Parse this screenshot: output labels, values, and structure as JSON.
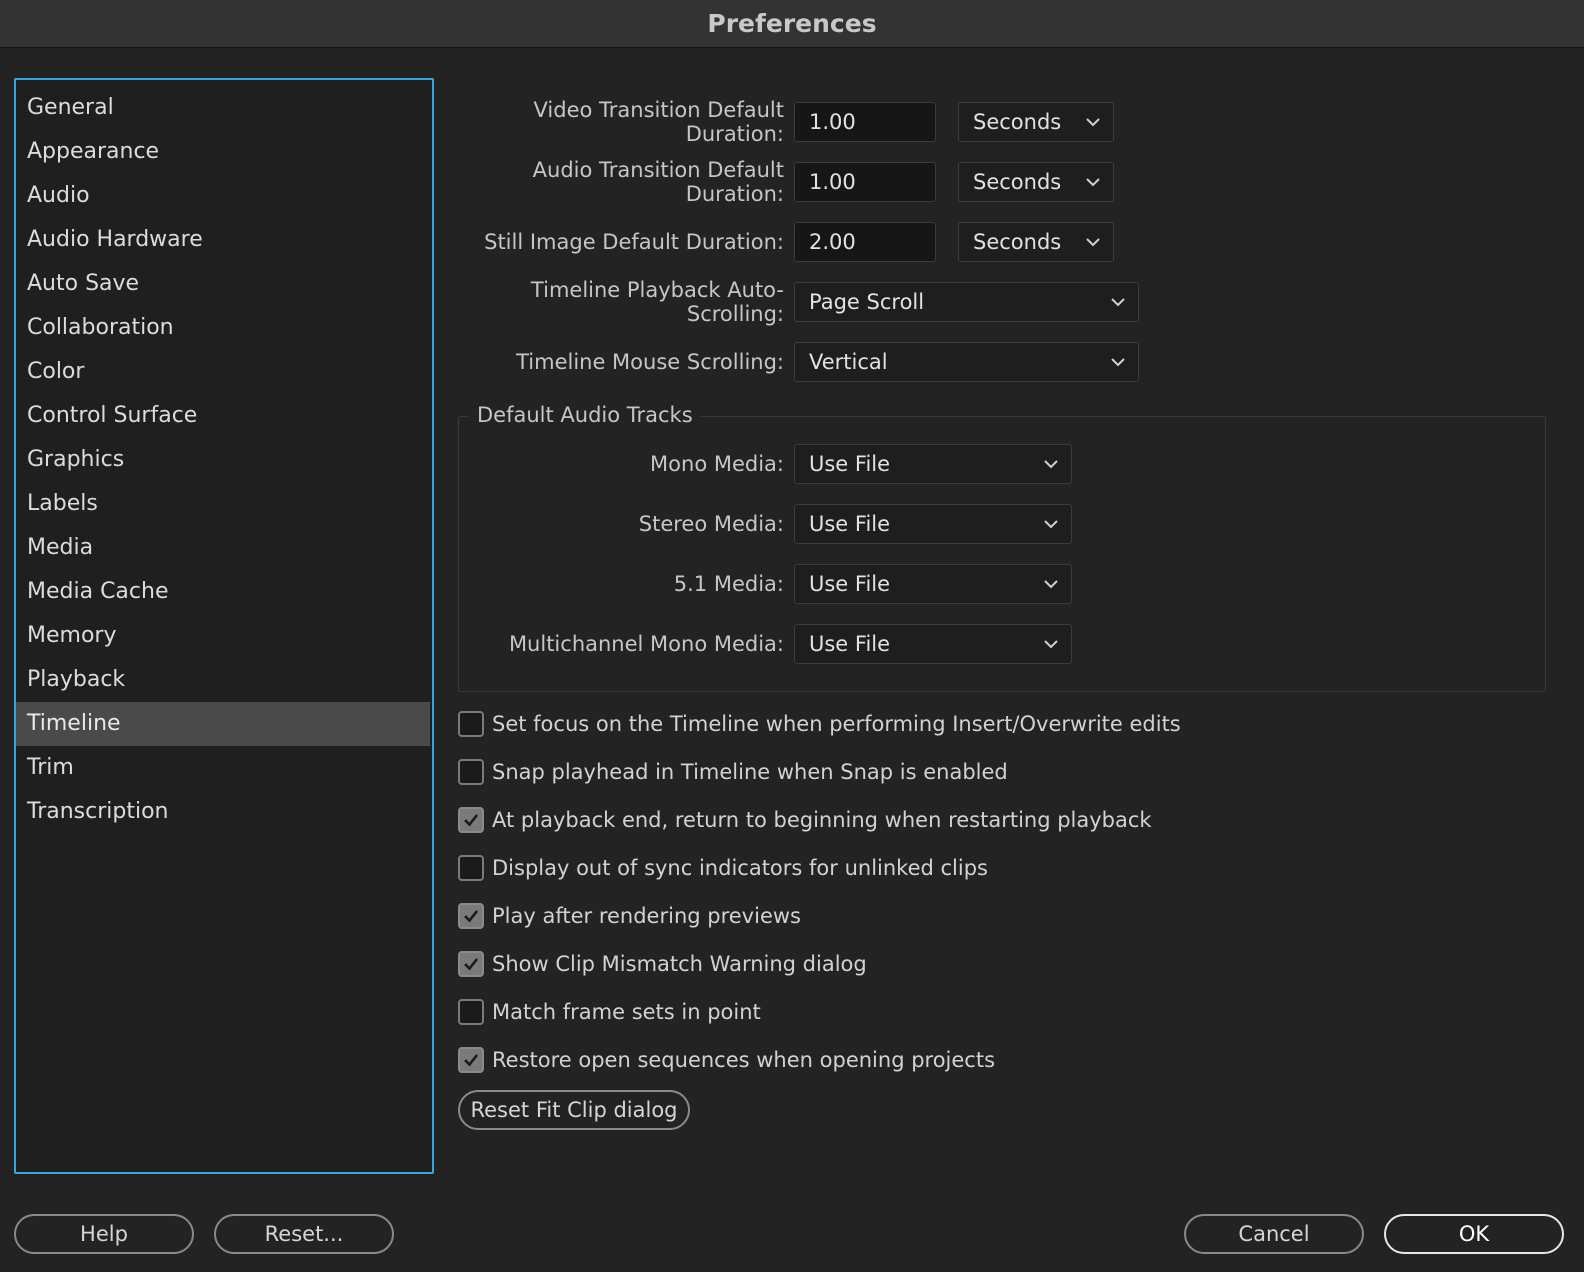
{
  "window": {
    "title": "Preferences"
  },
  "sidebar": {
    "items": [
      {
        "label": "General"
      },
      {
        "label": "Appearance"
      },
      {
        "label": "Audio"
      },
      {
        "label": "Audio Hardware"
      },
      {
        "label": "Auto Save"
      },
      {
        "label": "Collaboration"
      },
      {
        "label": "Color"
      },
      {
        "label": "Control Surface"
      },
      {
        "label": "Graphics"
      },
      {
        "label": "Labels"
      },
      {
        "label": "Media"
      },
      {
        "label": "Media Cache"
      },
      {
        "label": "Memory"
      },
      {
        "label": "Playback"
      },
      {
        "label": "Timeline"
      },
      {
        "label": "Trim"
      },
      {
        "label": "Transcription"
      }
    ],
    "selected": "Timeline"
  },
  "durations": {
    "video": {
      "label": "Video Transition Default Duration:",
      "value": "1.00",
      "unit": "Seconds"
    },
    "audio": {
      "label": "Audio Transition Default Duration:",
      "value": "1.00",
      "unit": "Seconds"
    },
    "still": {
      "label": "Still Image Default Duration:",
      "value": "2.00",
      "unit": "Seconds"
    }
  },
  "scrolling": {
    "playback": {
      "label": "Timeline Playback Auto-Scrolling:",
      "value": "Page Scroll"
    },
    "mouse": {
      "label": "Timeline Mouse Scrolling:",
      "value": "Vertical"
    }
  },
  "audio_tracks": {
    "title": "Default Audio Tracks",
    "mono": {
      "label": "Mono Media:",
      "value": "Use File"
    },
    "stereo": {
      "label": "Stereo Media:",
      "value": "Use File"
    },
    "surround": {
      "label": "5.1 Media:",
      "value": "Use File"
    },
    "multichannel": {
      "label": "Multichannel Mono Media:",
      "value": "Use File"
    }
  },
  "checkboxes": [
    {
      "label": "Set focus on the Timeline when performing Insert/Overwrite edits",
      "checked": false
    },
    {
      "label": "Snap playhead in Timeline when Snap is enabled",
      "checked": false
    },
    {
      "label": "At playback end, return to beginning when restarting playback",
      "checked": true
    },
    {
      "label": "Display out of sync indicators for unlinked clips",
      "checked": false
    },
    {
      "label": "Play after rendering previews",
      "checked": true
    },
    {
      "label": "Show Clip Mismatch Warning dialog",
      "checked": true
    },
    {
      "label": "Match frame sets in point",
      "checked": false
    },
    {
      "label": "Restore open sequences when opening projects",
      "checked": true
    }
  ],
  "reset_fit_clip": "Reset Fit Clip dialog",
  "footer": {
    "help": "Help",
    "reset": "Reset...",
    "cancel": "Cancel",
    "ok": "OK"
  }
}
